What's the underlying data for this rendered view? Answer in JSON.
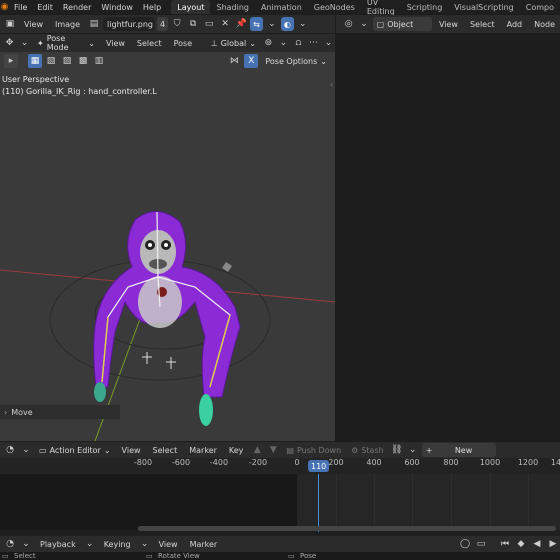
{
  "topbar": {
    "menus": [
      "File",
      "Edit",
      "Render",
      "Window",
      "Help"
    ],
    "workspaces": [
      "Layout",
      "Shading",
      "Animation",
      "GeoNodes",
      "UV Editing",
      "Scripting",
      "VisualScripting",
      "Compo"
    ],
    "active_workspace": "Layout"
  },
  "image_editor": {
    "menus": [
      "View",
      "Image"
    ],
    "image_name": "lightfur.png",
    "users_count": "4"
  },
  "node_editor": {
    "object_mode": "Object",
    "menus": [
      "View",
      "Select",
      "Add",
      "Node"
    ]
  },
  "viewport_header": {
    "mode": "Pose Mode",
    "menus": [
      "View",
      "Select",
      "Pose"
    ],
    "transform_orientation": "Global",
    "pose_options": "Pose Options"
  },
  "viewport": {
    "perspective_label": "User Perspective",
    "object_label": "(110) Gorilla_IK_Rig : hand_controller.L",
    "last_op_panel": "Move"
  },
  "action_editor": {
    "mode": "Action Editor",
    "menus": [
      "View",
      "Select",
      "Marker",
      "Key"
    ],
    "push_down": "Push Down",
    "stash": "Stash",
    "new_label": "New"
  },
  "timeline": {
    "ticks": [
      "-800",
      "-600",
      "-400",
      "-200",
      "0",
      "200",
      "400",
      "600",
      "800",
      "1000",
      "1200",
      "14"
    ],
    "current_frame": "110"
  },
  "playback": {
    "menus": [
      "Playback",
      "Keying",
      "View",
      "Marker"
    ]
  },
  "statusbar": {
    "items": [
      "Select",
      "Rotate View",
      "Pose"
    ]
  },
  "colors": {
    "accent": "#4772b3",
    "frame_indicator": "#4a90d9",
    "gorilla": "#8a2bd6"
  }
}
